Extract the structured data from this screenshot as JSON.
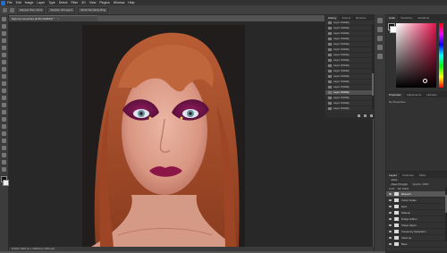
{
  "menu": [
    "File",
    "Edit",
    "Image",
    "Layer",
    "Type",
    "Select",
    "Filter",
    "3D",
    "View",
    "Plugins",
    "Window",
    "Help"
  ],
  "options_bar": [
    "Sample Size: Point",
    "Sample: All Layers",
    "Show Sampling Ring"
  ],
  "document_tab": "high-res retouched (8.3% RGB/16) *",
  "status": "8.33%   7000 px x 10000 px (300 ppi)",
  "history": {
    "tabs": [
      "History",
      "Actions",
      "Brushes"
    ],
    "rows": [
      "Layer Visibility",
      "Layer Visibility",
      "Layer Visibility",
      "Layer Visibility",
      "Layer Visibility",
      "Layer Visibility",
      "Layer Visibility",
      "Layer Visibility",
      "Layer Visibility",
      "Layer Visibility",
      "Layer Visibility",
      "Layer Visibility",
      "Layer Visibility",
      "Layer Visibility",
      "Layer Visibility",
      "Layer Visibility",
      "Layer Visibility",
      "Layer Visibility"
    ],
    "selected_index": 13
  },
  "color": {
    "tabs": [
      "Color",
      "Swatches",
      "Gradients"
    ],
    "hue": "#e6134d"
  },
  "properties": {
    "tabs": [
      "Properties",
      "Adjustments",
      "Libraries"
    ],
    "text": "No Properties"
  },
  "layers": {
    "tabs": [
      "Layers",
      "Channels",
      "Paths"
    ],
    "kind": "Kind",
    "mode": "Pass Through",
    "opacity": "Opacity: 100%",
    "lock": "Lock:",
    "fill": "Fill: 100%",
    "rows": [
      "Retouch",
      "Colour Grade",
      "Eyes",
      "Makeup",
      "Dodge & Burn",
      "Shape Adjust",
      "Frequency Separation",
      "Clean up",
      "Base"
    ],
    "selected_index": 0
  }
}
